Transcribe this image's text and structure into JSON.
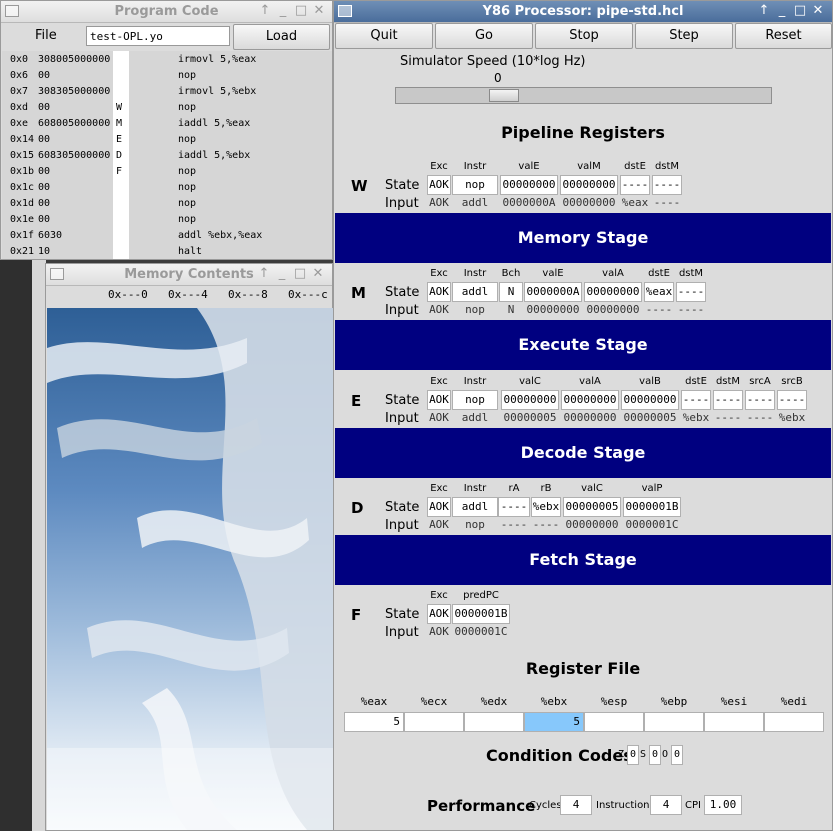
{
  "program_window": {
    "title": "Program Code",
    "file_label": "File",
    "file_value": "test-OPL.yo",
    "load_label": "Load",
    "lines": [
      {
        "addr": "0x0",
        "code": "308005000000",
        "stage": "",
        "instr": "irmovl 5,%eax"
      },
      {
        "addr": "0x6",
        "code": "00",
        "stage": "",
        "instr": "nop"
      },
      {
        "addr": "0x7",
        "code": "308305000000",
        "stage": "",
        "instr": "irmovl 5,%ebx"
      },
      {
        "addr": "0xd",
        "code": "00",
        "stage": "W",
        "instr": "nop"
      },
      {
        "addr": "0xe",
        "code": "608005000000",
        "stage": "M",
        "instr": "iaddl 5,%eax"
      },
      {
        "addr": "0x14",
        "code": "00",
        "stage": "E",
        "instr": "nop"
      },
      {
        "addr": "0x15",
        "code": "608305000000",
        "stage": "D",
        "instr": "iaddl 5,%ebx"
      },
      {
        "addr": "0x1b",
        "code": "00",
        "stage": "F",
        "instr": "nop"
      },
      {
        "addr": "0x1c",
        "code": "00",
        "stage": "",
        "instr": "nop"
      },
      {
        "addr": "0x1d",
        "code": "00",
        "stage": "",
        "instr": "nop"
      },
      {
        "addr": "0x1e",
        "code": "00",
        "stage": "",
        "instr": "nop"
      },
      {
        "addr": "0x1f",
        "code": "6030",
        "stage": "",
        "instr": "addl %ebx,%eax"
      },
      {
        "addr": "0x21",
        "code": "10",
        "stage": "",
        "instr": "halt"
      }
    ]
  },
  "memory_window": {
    "title": "Memory Contents",
    "cols": [
      "0x---0",
      "0x---4",
      "0x---8",
      "0x---c"
    ]
  },
  "processor_window": {
    "title": "Y86 Processor: pipe-std.hcl",
    "buttons": [
      "Quit",
      "Go",
      "Stop",
      "Step",
      "Reset"
    ],
    "speed_label": "Simulator Speed (10*log Hz)",
    "speed_value": "0",
    "speed_fraction": 0.27,
    "pipeline_title": "Pipeline Registers",
    "row_state": "State",
    "row_input": "Input",
    "W": {
      "label": "W",
      "headers": [
        "Exc",
        "Instr",
        "valE",
        "valM",
        "dstE",
        "dstM"
      ],
      "state": [
        "AOK",
        "nop",
        "00000000",
        "00000000",
        "----",
        "----"
      ],
      "input": [
        "AOK",
        "addl",
        "0000000A",
        "00000000",
        "%eax",
        "----"
      ]
    },
    "memory_stage": "Memory Stage",
    "M": {
      "label": "M",
      "headers": [
        "Exc",
        "Instr",
        "Bch",
        "valE",
        "valA",
        "dstE",
        "dstM"
      ],
      "state": [
        "AOK",
        "addl",
        "N",
        "0000000A",
        "00000000",
        "%eax",
        "----"
      ],
      "input": [
        "AOK",
        "nop",
        "N",
        "00000000",
        "00000000",
        "----",
        "----"
      ]
    },
    "execute_stage": "Execute Stage",
    "E": {
      "label": "E",
      "headers": [
        "Exc",
        "Instr",
        "valC",
        "valA",
        "valB",
        "dstE",
        "dstM",
        "srcA",
        "srcB"
      ],
      "state": [
        "AOK",
        "nop",
        "00000000",
        "00000000",
        "00000000",
        "----",
        "----",
        "----",
        "----"
      ],
      "input": [
        "AOK",
        "addl",
        "00000005",
        "00000000",
        "00000005",
        "%ebx",
        "----",
        "----",
        "%ebx"
      ]
    },
    "decode_stage": "Decode Stage",
    "D": {
      "label": "D",
      "headers": [
        "Exc",
        "Instr",
        "rA",
        "rB",
        "valC",
        "valP"
      ],
      "state": [
        "AOK",
        "addl",
        "----",
        "%ebx",
        "00000005",
        "0000001B"
      ],
      "input": [
        "AOK",
        "nop",
        "----",
        "----",
        "00000000",
        "0000001C"
      ]
    },
    "fetch_stage": "Fetch Stage",
    "F": {
      "label": "F",
      "headers": [
        "Exc",
        "predPC"
      ],
      "state": [
        "AOK",
        "0000001B"
      ],
      "input": [
        "AOK",
        "0000001C"
      ]
    },
    "regfile_title": "Register File",
    "registers": [
      {
        "name": "%eax",
        "value": "5"
      },
      {
        "name": "%ecx",
        "value": ""
      },
      {
        "name": "%edx",
        "value": ""
      },
      {
        "name": "%ebx",
        "value": "5"
      },
      {
        "name": "%esp",
        "value": ""
      },
      {
        "name": "%ebp",
        "value": ""
      },
      {
        "name": "%esi",
        "value": ""
      },
      {
        "name": "%edi",
        "value": ""
      }
    ],
    "highlight_color": "#87c8fb",
    "cc_title": "Condition Codes",
    "cc": [
      {
        "name": "Z",
        "value": "0"
      },
      {
        "name": "S",
        "value": "0"
      },
      {
        "name": "O",
        "value": "0"
      }
    ],
    "perf_title": "Performance",
    "cycles_label": "Cycles",
    "cycles": "4",
    "instr_label": "Instructions",
    "instructions": "4",
    "cpi_label": "CPI",
    "cpi": "1.00",
    "section_color": "#000080"
  }
}
